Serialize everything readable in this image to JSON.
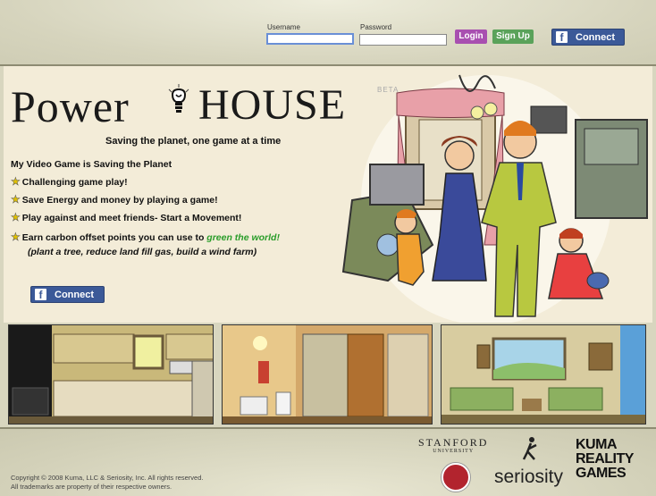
{
  "header": {
    "username_label": "Username",
    "password_label": "Password",
    "login_label": "Login",
    "signup_label": "Sign Up",
    "connect_label": "Connect"
  },
  "logo": {
    "part1": "Power",
    "part2": "HOUSE",
    "beta": "BETA"
  },
  "tagline": "Saving the planet, one game at a time",
  "features": {
    "heading": "My Video Game is Saving the Planet",
    "items": [
      "Challenging game play!",
      "Save Energy and money by playing a game!",
      "Play against and meet friends- Start a Movement!"
    ],
    "carbon_prefix": "Earn carbon offset points you can use to ",
    "carbon_highlight": "green the world!",
    "carbon_sub": "(plant a tree, reduce land fill gas, build a wind farm)"
  },
  "main_connect_label": "Connect",
  "footer": {
    "copyright": "Copyright © 2008 Kuma, LLC & Seriosity, Inc. All rights reserved.",
    "trademarks": "All trademarks are property of their respective owners.",
    "stanford_name": "STANFORD",
    "stanford_sub": "UNIVERSITY",
    "seriosity": "seriosity",
    "kuma_lines": [
      "KUMA",
      "REALITY",
      "GAMES"
    ]
  },
  "colors": {
    "login_button": "#a84fb0",
    "signup_button": "#5aa25a",
    "facebook_blue": "#3b5998",
    "highlight_green": "#2a9d2a",
    "star_yellow": "#e0c000"
  }
}
